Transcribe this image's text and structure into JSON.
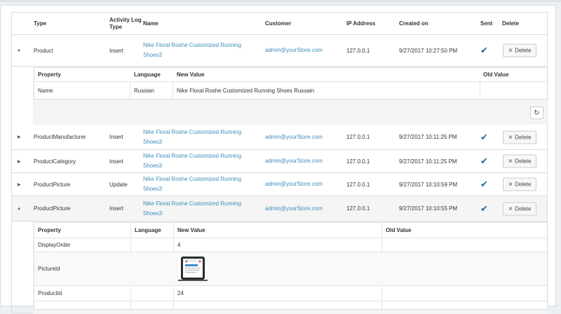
{
  "table": {
    "headers": {
      "type": "Type",
      "activity": "Activity Log Type",
      "name": "Name",
      "customer": "Customer",
      "ip": "IP Address",
      "created": "Created on",
      "sent": "Sent",
      "delete": "Delete"
    },
    "rows": [
      {
        "type": "Product",
        "activity": "Insert",
        "name_line1": "Nike Floral Roshe Customized Running",
        "name_line2": "Shoes3",
        "customer": "admin@yourStore.com",
        "ip": "127.0.0.1",
        "created": "9/27/2017 10:27:50 PM",
        "delete": "Delete"
      },
      {
        "type": "ProductManufacturer",
        "activity": "Insert",
        "name_line1": "Nike Floral Roshe Customized Running",
        "name_line2": "Shoes3",
        "customer": "admin@yourStore.com",
        "ip": "127.0.0.1",
        "created": "9/27/2017 10:11:25 PM",
        "delete": "Delete"
      },
      {
        "type": "ProductCategory",
        "activity": "Insert",
        "name_line1": "Nike Floral Roshe Customized Running",
        "name_line2": "Shoes3",
        "customer": "admin@yourStore.com",
        "ip": "127.0.0.1",
        "created": "9/27/2017 10:11:25 PM",
        "delete": "Delete"
      },
      {
        "type": "ProductPicture",
        "activity": "Update",
        "name_line1": "Nike Floral Roshe Customized Running",
        "name_line2": "Shoes3",
        "customer": "admin@yourStore.com",
        "ip": "127.0.0.1",
        "created": "9/27/2017 10:10:59 PM",
        "delete": "Delete"
      },
      {
        "type": "ProductPicture",
        "activity": "Insert",
        "name_line1": "Nike Floral Roshe Customized Running",
        "name_line2": "Shoes3",
        "customer": "admin@yourStore.com",
        "ip": "127.0.0.1",
        "created": "9/27/2017 10:10:55 PM",
        "delete": "Delete"
      }
    ]
  },
  "detail1": {
    "headers": {
      "property": "Property",
      "language": "Language",
      "new_value": "New Value",
      "old_value": "Old Value"
    },
    "rows": [
      {
        "property": "Name",
        "language": "Russian",
        "new_value": "Nike Floral Roshe Customized Running Shoes Russain",
        "old_value": ""
      }
    ]
  },
  "detail2": {
    "headers": {
      "property": "Property",
      "language": "Language",
      "new_value": "New Value",
      "old_value": "Old Value"
    },
    "rows": [
      {
        "property": "DisplayOrder",
        "language": "",
        "new_value": "4",
        "old_value": ""
      },
      {
        "property": "PictureId",
        "language": "",
        "new_value": "",
        "old_value": ""
      },
      {
        "property": "ProductId",
        "language": "",
        "new_value": "24",
        "old_value": ""
      }
    ]
  },
  "icons": {
    "expanded": "caret-down-icon",
    "collapsed": "caret-right-icon",
    "sent": "checkmark-icon",
    "refresh": "refresh-icon",
    "delete": "close-icon"
  },
  "colors": {
    "link": "#3c8dbc",
    "check": "#1c6ea4",
    "background": "#ecf0f5"
  }
}
